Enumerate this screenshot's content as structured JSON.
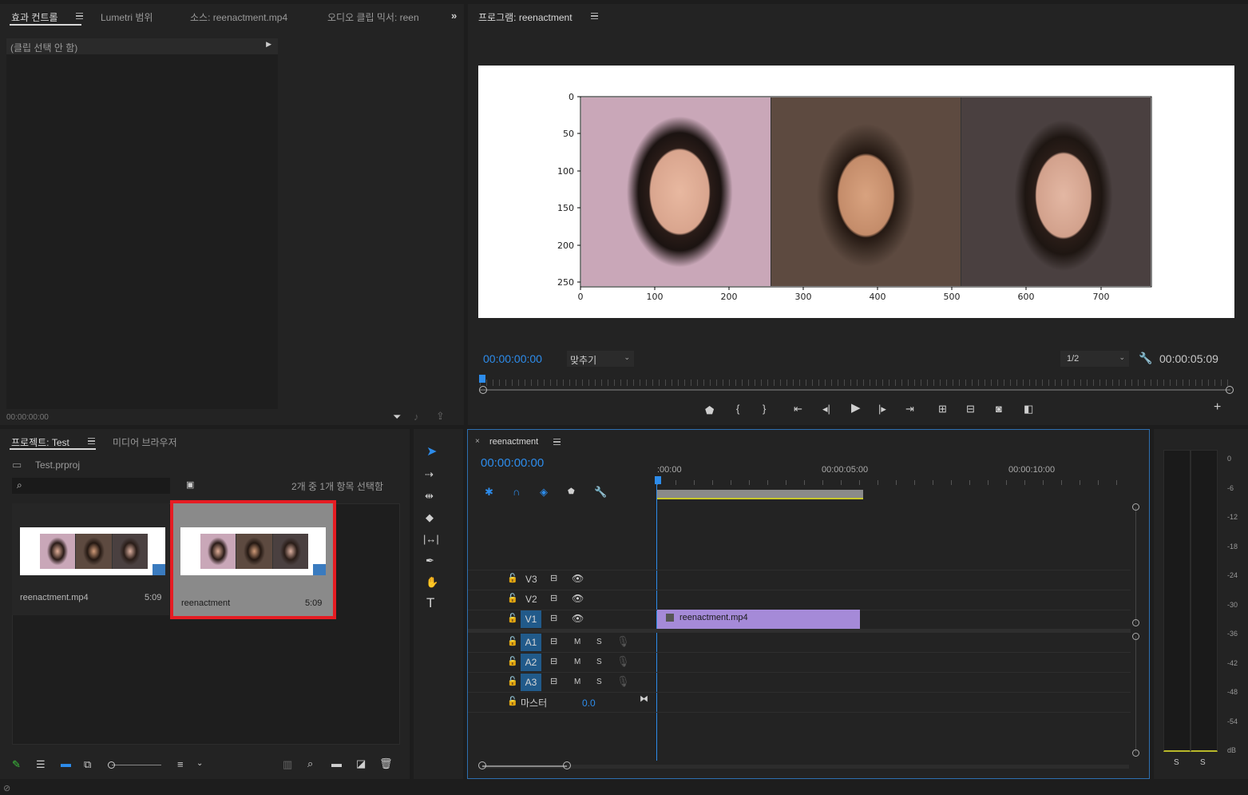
{
  "effect_panel": {
    "tabs": [
      "효과 컨트롤",
      "Lumetri 범위",
      "소스: reenactment.mp4",
      "오디오 클립 믹서: reen"
    ],
    "no_clip": "(클립 선택 안 함)",
    "timecode": "00:00:00:00"
  },
  "program": {
    "tab": "프로그램: reenactment",
    "timecode": "00:00:00:00",
    "fit": "맞추기",
    "resolution": "1/2",
    "duration": "00:00:05:09",
    "plot": {
      "yticks": [
        "0",
        "50",
        "100",
        "150",
        "200",
        "250"
      ],
      "xticks": [
        "0",
        "100",
        "200",
        "300",
        "400",
        "500",
        "600",
        "700"
      ]
    }
  },
  "project": {
    "tab": "프로젝트: Test",
    "media_tab": "미디어 브라우저",
    "file": "Test.prproj",
    "search_placeholder": "",
    "selection": "2개 중 1개 항목 선택함",
    "items": [
      {
        "name": "reenactment.mp4",
        "duration": "5:09"
      },
      {
        "name": "reenactment",
        "duration": "5:09"
      }
    ]
  },
  "timeline": {
    "tab": "reenactment",
    "timecode": "00:00:00:00",
    "ruler": [
      ":00:00",
      "00:00:05:00",
      "00:00:10:00"
    ],
    "video_tracks": [
      "V3",
      "V2",
      "V1"
    ],
    "audio_tracks": [
      "A1",
      "A2",
      "A3"
    ],
    "master": "마스터",
    "master_value": "0.0",
    "clip": "reenactment.mp4",
    "m_label": "M",
    "s_label": "S"
  },
  "meter": {
    "scale": [
      "0",
      "-6",
      "-12",
      "-18",
      "-24",
      "-30",
      "-36",
      "-42",
      "-48",
      "-54",
      "dB"
    ],
    "solo": [
      "S",
      "S"
    ]
  },
  "colors": {
    "accent": "#2d8ceb",
    "clip": "#a58ad8",
    "highlight": "#e51c23"
  }
}
